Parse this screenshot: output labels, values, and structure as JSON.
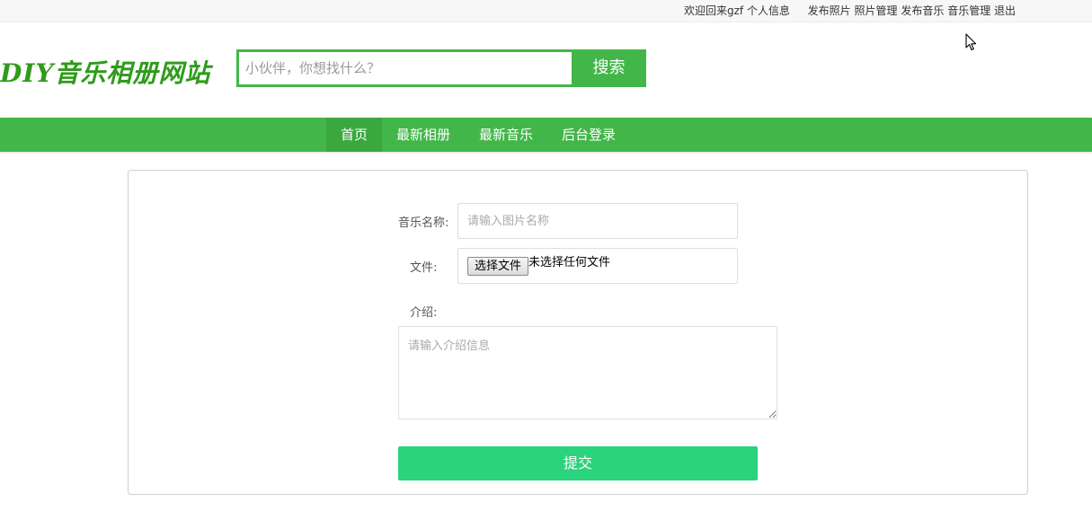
{
  "topbar": {
    "welcome": "欢迎回来gzf",
    "profile": "个人信息",
    "publish_photo": "发布照片",
    "photo_manage": "照片管理",
    "publish_music": "发布音乐",
    "music_manage": "音乐管理",
    "logout": "退出"
  },
  "header": {
    "logo_text": "DIY音乐相册网站",
    "search_placeholder": "小伙伴，你想找什么？",
    "search_button": "搜索"
  },
  "nav": {
    "items": [
      {
        "label": "首页",
        "active": true
      },
      {
        "label": "最新相册",
        "active": false
      },
      {
        "label": "最新音乐",
        "active": false
      },
      {
        "label": "后台登录",
        "active": false
      }
    ]
  },
  "form": {
    "name_label": "音乐名称:",
    "name_placeholder": "请输入图片名称",
    "file_label": "文件:",
    "file_button": "选择文件",
    "file_status": "未选择任何文件",
    "intro_label": "介绍:",
    "intro_placeholder": "请输入介绍信息",
    "submit_label": "提交"
  },
  "colors": {
    "brand_green": "#43b649",
    "submit_green": "#2ad37c",
    "logo_green": "#2e9b1a"
  }
}
